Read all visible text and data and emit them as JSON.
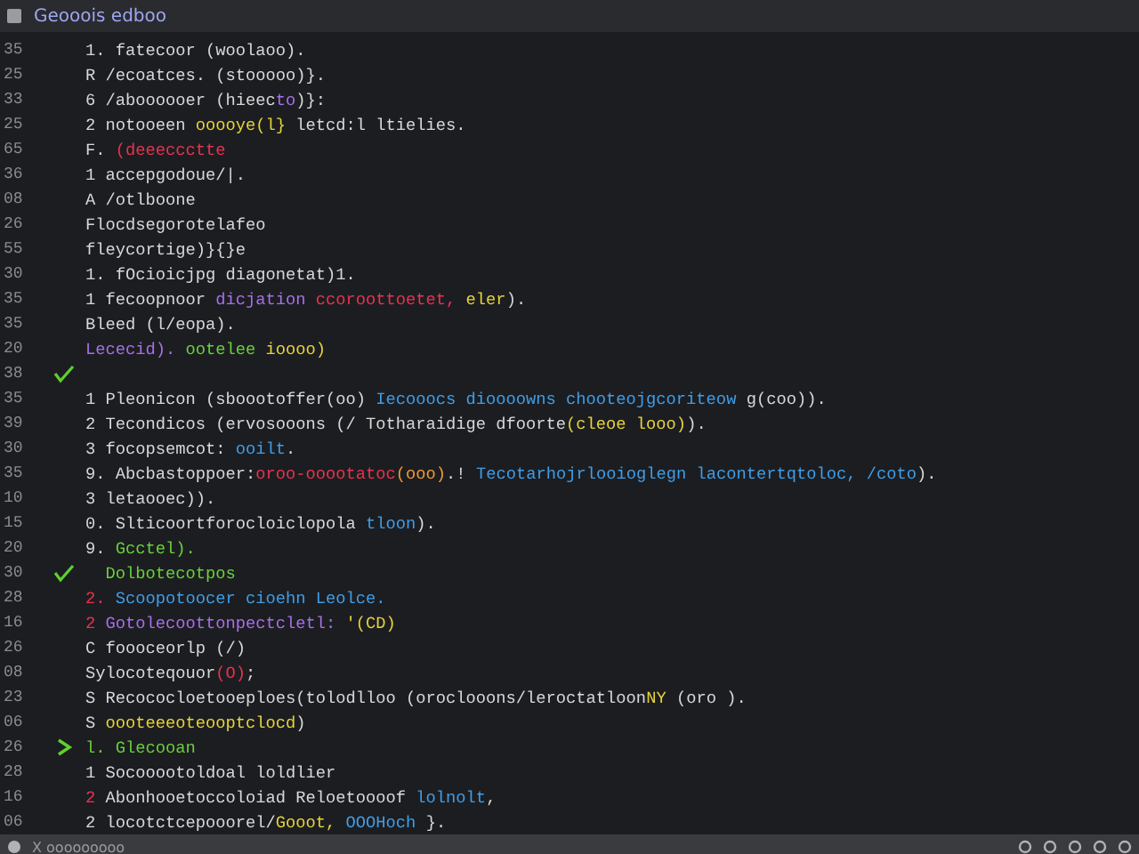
{
  "window": {
    "title": "Geooois edboo"
  },
  "lines": [
    {
      "number": "35",
      "kind": "code",
      "tokens": [
        {
          "text": "1. fatecoor (woolaoo).",
          "kind": "plain"
        }
      ]
    },
    {
      "number": "25",
      "kind": "code",
      "tokens": [
        {
          "text": "R /ecoatces. (stooooo)}.",
          "kind": "plain"
        }
      ]
    },
    {
      "number": "33",
      "kind": "code",
      "tokens": [
        {
          "text": "6 /aboooooer (hieec",
          "kind": "plain"
        },
        {
          "text": "to",
          "kind": "purple"
        },
        {
          "text": ")}:",
          "kind": "plain"
        }
      ]
    },
    {
      "number": "25",
      "kind": "code",
      "tokens": [
        {
          "text": "2 notooeen ",
          "kind": "plain"
        },
        {
          "text": "ooooye(l}",
          "kind": "keyword"
        },
        {
          "text": " letcd:l ltielies.",
          "kind": "plain"
        }
      ]
    },
    {
      "number": "65",
      "kind": "code",
      "tokens": [
        {
          "text": "F. ",
          "kind": "plain"
        },
        {
          "text": "(deeeccctte",
          "kind": "error"
        }
      ]
    },
    {
      "number": "36",
      "kind": "code",
      "tokens": [
        {
          "text": "1 accepgodoue/|.",
          "kind": "plain"
        }
      ]
    },
    {
      "number": "08",
      "kind": "code",
      "tokens": [
        {
          "text": "A /otlboone",
          "kind": "plain"
        }
      ]
    },
    {
      "number": "26",
      "kind": "code",
      "tokens": [
        {
          "text": "Flocdsegorotelafeo",
          "kind": "plain"
        }
      ]
    },
    {
      "number": "55",
      "kind": "code",
      "tokens": [
        {
          "text": "fleycortige)}{}e",
          "kind": "plain"
        }
      ]
    },
    {
      "number": "30",
      "kind": "code",
      "tokens": [
        {
          "text": "1. fOcioicjpg diagonetat)1.",
          "kind": "plain"
        }
      ]
    },
    {
      "number": "35",
      "kind": "code",
      "tokens": [
        {
          "text": "1 fecoopnoor ",
          "kind": "plain"
        },
        {
          "text": "dicjation",
          "kind": "purple"
        },
        {
          "text": " ccoroottoetet, ",
          "kind": "error"
        },
        {
          "text": "eler",
          "kind": "keyword"
        },
        {
          "text": ").",
          "kind": "plain"
        }
      ]
    },
    {
      "number": "35",
      "kind": "code",
      "tokens": [
        {
          "text": "Bleed (l/eopa).",
          "kind": "plain"
        }
      ]
    },
    {
      "number": "20",
      "kind": "code",
      "tokens": [
        {
          "text": "Lececid).",
          "kind": "purple"
        },
        {
          "text": " ootelee ",
          "kind": "green"
        },
        {
          "text": "ioooo)",
          "kind": "keyword"
        }
      ]
    },
    {
      "number": "38",
      "kind": "check"
    },
    {
      "number": "35",
      "kind": "code",
      "tokens": [
        {
          "text": "1 Pleonicon (sboootoffer(oo) ",
          "kind": "plain"
        },
        {
          "text": "Iecooocs dioooowns chooteojgcoriteow",
          "kind": "string"
        },
        {
          "text": " g(coo)).",
          "kind": "plain"
        }
      ]
    },
    {
      "number": "39",
      "kind": "code",
      "tokens": [
        {
          "text": "2 Tecondicos (ervosooons (/ Totharaidige dfoorte",
          "kind": "plain"
        },
        {
          "text": "(cleoe looo)",
          "kind": "keyword"
        },
        {
          "text": ").",
          "kind": "plain"
        }
      ]
    },
    {
      "number": "30",
      "kind": "code",
      "tokens": [
        {
          "text": "3 focopsemcot: ",
          "kind": "plain"
        },
        {
          "text": "ooilt",
          "kind": "string"
        },
        {
          "text": ".",
          "kind": "plain"
        }
      ]
    },
    {
      "number": "35",
      "kind": "code",
      "tokens": [
        {
          "text": "9. Abcbastoppoer:",
          "kind": "plain"
        },
        {
          "text": "oroo-ooootatoc",
          "kind": "error"
        },
        {
          "text": "(ooo)",
          "kind": "orange"
        },
        {
          "text": ".! ",
          "kind": "plain"
        },
        {
          "text": "Tecotarhojrlooioglegn lacontertqtoloc, /coto",
          "kind": "string"
        },
        {
          "text": ").",
          "kind": "plain"
        }
      ]
    },
    {
      "number": "10",
      "kind": "code",
      "tokens": [
        {
          "text": "3 letaooec)).",
          "kind": "plain"
        }
      ]
    },
    {
      "number": "15",
      "kind": "code",
      "tokens": [
        {
          "text": "0. Slticoortforocloiclopola ",
          "kind": "plain"
        },
        {
          "text": "tloon",
          "kind": "string"
        },
        {
          "text": ").",
          "kind": "plain"
        }
      ]
    },
    {
      "number": "20",
      "kind": "code",
      "tokens": [
        {
          "text": "9. ",
          "kind": "plain"
        },
        {
          "text": "Gcctel).",
          "kind": "green"
        }
      ]
    },
    {
      "number": "30",
      "kind": "check",
      "tokens": [
        {
          "text": "  Dolbotecotpos",
          "kind": "green"
        }
      ]
    },
    {
      "number": "28",
      "kind": "code",
      "tokens": [
        {
          "text": "2. ",
          "kind": "error"
        },
        {
          "text": "Scoopotoocer cioehn Leolce.",
          "kind": "string"
        }
      ]
    },
    {
      "number": "16",
      "kind": "code",
      "tokens": [
        {
          "text": "2 ",
          "kind": "error"
        },
        {
          "text": "Gotolecoottonpectcletl: ",
          "kind": "purple"
        },
        {
          "text": "'(CD)",
          "kind": "keyword"
        }
      ]
    },
    {
      "number": "26",
      "kind": "code",
      "tokens": [
        {
          "text": "C foooceorlp (/)",
          "kind": "plain"
        }
      ]
    },
    {
      "number": "08",
      "kind": "code",
      "tokens": [
        {
          "text": "Sylocoteqouor",
          "kind": "plain"
        },
        {
          "text": "(O)",
          "kind": "error"
        },
        {
          "text": ";",
          "kind": "plain"
        }
      ]
    },
    {
      "number": "23",
      "kind": "code",
      "tokens": [
        {
          "text": "S Recococloetooeploes(tolodlloo (oroclooons/leroctatloon",
          "kind": "plain"
        },
        {
          "text": "NY",
          "kind": "keyword"
        },
        {
          "text": " (oro ).",
          "kind": "plain"
        }
      ]
    },
    {
      "number": "06",
      "kind": "code",
      "tokens": [
        {
          "text": "S ",
          "kind": "plain"
        },
        {
          "text": "oooteeeoteooptclocd",
          "kind": "keyword"
        },
        {
          "text": ")",
          "kind": "plain"
        }
      ]
    },
    {
      "number": "26",
      "kind": "arrow",
      "tokens": [
        {
          "text": "l. Glecooan",
          "kind": "green"
        }
      ]
    },
    {
      "number": "28",
      "kind": "code",
      "tokens": [
        {
          "text": "1 Socooootoldoal loldlier",
          "kind": "plain"
        }
      ]
    },
    {
      "number": "16",
      "kind": "code",
      "tokens": [
        {
          "text": "2 ",
          "kind": "error"
        },
        {
          "text": "Abonhooetoccoloiad Reloetoooof ",
          "kind": "plain"
        },
        {
          "text": "lolnolt",
          "kind": "string"
        },
        {
          "text": ",",
          "kind": "plain"
        }
      ]
    },
    {
      "number": "06",
      "kind": "code",
      "tokens": [
        {
          "text": "2 locotctcepooorel/",
          "kind": "plain"
        },
        {
          "text": "Gooot, ",
          "kind": "keyword"
        },
        {
          "text": "OOOHoch",
          "kind": "string"
        },
        {
          "text": " }.",
          "kind": "plain"
        }
      ]
    }
  ],
  "status_bar": {
    "text": "X ooooooooo"
  }
}
